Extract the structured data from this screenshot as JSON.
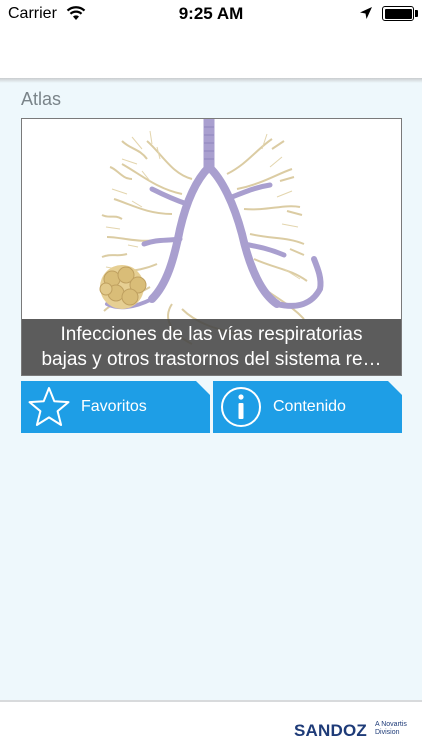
{
  "status_bar": {
    "carrier": "Carrier",
    "time": "9:25 AM",
    "wifi_icon": "wifi-icon",
    "location_icon": "location-arrow-icon",
    "battery_icon": "battery-full-icon"
  },
  "section": {
    "title": "Atlas"
  },
  "atlas_card": {
    "image": "respiratory-tract-illustration",
    "caption_line1": "Infecciones de las vías respiratorias",
    "caption_line2": "bajas y otros trastornos del sistema re…"
  },
  "buttons": {
    "favorites": {
      "label": "Favoritos",
      "icon": "star-outline-icon"
    },
    "contents": {
      "label": "Contenido",
      "icon": "info-circle-icon"
    }
  },
  "footer": {
    "logo_text": "SANDOZ",
    "logo_sub_line1": "A Novartis",
    "logo_sub_line2": "Division"
  },
  "colors": {
    "accent": "#1e9ee6",
    "background": "#eef8fc",
    "brand": "#1e3b78",
    "caption_bg": "#464646"
  }
}
